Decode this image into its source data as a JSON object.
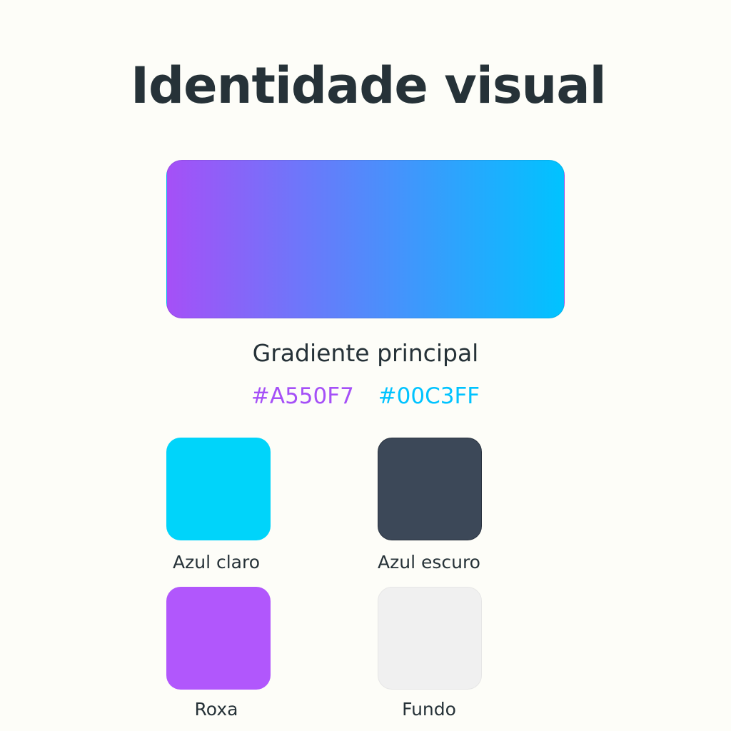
{
  "header": {
    "title": "Identidade visual"
  },
  "gradient": {
    "label": "Gradiente principal",
    "start_color": "#A550F7",
    "end_color": "#00C3FF",
    "start_hex": "#A550F7",
    "end_hex": "#00C3FF"
  },
  "swatches": [
    {
      "label": "Azul claro",
      "color": "#00D4FA"
    },
    {
      "label": "Azul escuro",
      "color": "#3C4858"
    },
    {
      "label": "Roxa",
      "color": "#B157FC"
    },
    {
      "label": "Fundo",
      "color": "#F0F0F0"
    }
  ]
}
